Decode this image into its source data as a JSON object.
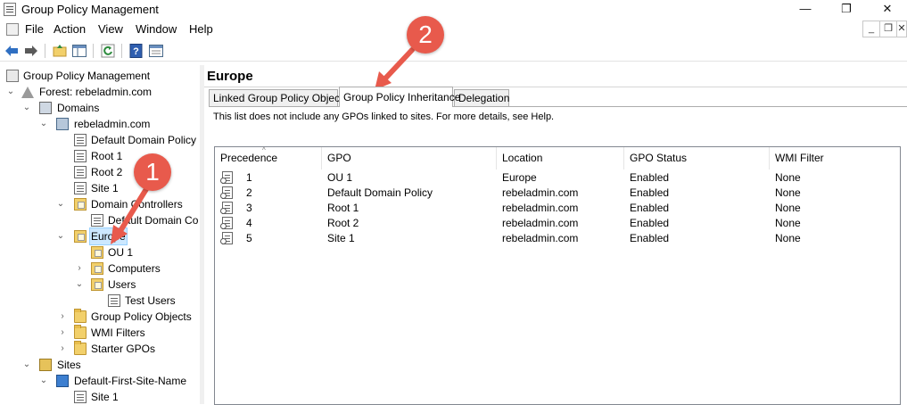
{
  "window": {
    "title": "Group Policy Management",
    "controls": {
      "minimize": "—",
      "maximize": "❐",
      "close": "✕"
    }
  },
  "menu": {
    "items": [
      "File",
      "Action",
      "View",
      "Window",
      "Help"
    ]
  },
  "mdi_controls": {
    "minimize": "_",
    "restore": "❐",
    "close": "✕"
  },
  "toolbar": {
    "icons": [
      "back-arrow-icon",
      "forward-arrow-icon",
      "up-folder-icon",
      "show-hide-tree-icon",
      "refresh-icon",
      "help-icon",
      "properties-icon"
    ]
  },
  "tree": {
    "items": [
      {
        "label": "Group Policy Management",
        "icon": "gpm-icon",
        "twisty": ""
      },
      {
        "label": "Forest: rebeladmin.com",
        "icon": "forest-icon",
        "twisty": "⌄"
      },
      {
        "label": "Domains",
        "icon": "domains-icon",
        "twisty": "⌄"
      },
      {
        "label": "rebeladmin.com",
        "icon": "domain-icon",
        "twisty": "⌄"
      },
      {
        "label": "Default Domain Policy",
        "icon": "gpo-link-icon",
        "twisty": ""
      },
      {
        "label": "Root 1",
        "icon": "gpo-link-icon",
        "twisty": ""
      },
      {
        "label": "Root 2",
        "icon": "gpo-link-icon",
        "twisty": ""
      },
      {
        "label": "Site 1",
        "icon": "gpo-link-icon",
        "twisty": ""
      },
      {
        "label": "Domain Controllers",
        "icon": "ou-icon",
        "twisty": "⌄"
      },
      {
        "label": "Default Domain Co",
        "icon": "gpo-link-icon",
        "twisty": ""
      },
      {
        "label": "Europe",
        "icon": "ou-icon",
        "twisty": "⌄"
      },
      {
        "label": "OU 1",
        "icon": "ou-icon",
        "twisty": ""
      },
      {
        "label": "Computers",
        "icon": "ou-icon",
        "twisty": "›"
      },
      {
        "label": "Users",
        "icon": "ou-icon",
        "twisty": "⌄"
      },
      {
        "label": "Test Users",
        "icon": "gpo-link-icon",
        "twisty": ""
      },
      {
        "label": "Group Policy Objects",
        "icon": "folder-icon",
        "twisty": "›"
      },
      {
        "label": "WMI Filters",
        "icon": "folder-icon",
        "twisty": "›"
      },
      {
        "label": "Starter GPOs",
        "icon": "folder-icon",
        "twisty": "›"
      },
      {
        "label": "Sites",
        "icon": "sites-icon",
        "twisty": "⌄"
      },
      {
        "label": "Default-First-Site-Name",
        "icon": "site-icon",
        "twisty": "⌄"
      },
      {
        "label": "Site 1",
        "icon": "gpo-link-icon",
        "twisty": ""
      }
    ]
  },
  "content": {
    "title": "Europe",
    "tabs": [
      "Linked Group Policy Objects",
      "Group Policy Inheritance",
      "Delegation"
    ],
    "active_tab": "Group Policy Inheritance",
    "info": "This list does not include any GPOs linked to sites. For more details, see Help.",
    "table": {
      "columns": [
        "Precedence",
        "GPO",
        "Location",
        "GPO Status",
        "WMI Filter"
      ],
      "sort_indicator": "^",
      "rows": [
        [
          "1",
          "OU 1",
          "Europe",
          "Enabled",
          "None"
        ],
        [
          "2",
          "Default Domain Policy",
          "rebeladmin.com",
          "Enabled",
          "None"
        ],
        [
          "3",
          "Root 1",
          "rebeladmin.com",
          "Enabled",
          "None"
        ],
        [
          "4",
          "Root 2",
          "rebeladmin.com",
          "Enabled",
          "None"
        ],
        [
          "5",
          "Site 1",
          "rebeladmin.com",
          "Enabled",
          "None"
        ]
      ]
    }
  },
  "annotations": {
    "callout_1": "1",
    "callout_2": "2",
    "color": "#e85a4c"
  }
}
